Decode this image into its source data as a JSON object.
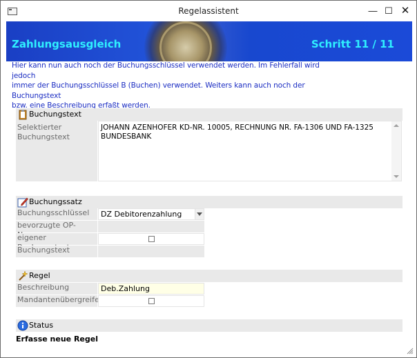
{
  "window": {
    "title": "Regelassistent",
    "minimize_glyph": "—",
    "maximize_glyph": "☐",
    "close_glyph": "✕"
  },
  "banner": {
    "title": "Zahlungsausgleich",
    "step": "Schritt 11 / 11",
    "accent_color": "#2ff0ff",
    "background_color": "#1b4ad8"
  },
  "intro": {
    "lines": [
      "Hier kann nun auch noch der Buchungsschlüssel verwendet werden. Im Fehlerfall wird jedoch",
      "immer der Buchungsschlüssel B (Buchen) verwendet. Weiters kann auch noch der Buchungstext",
      "bzw. eine Beschreibung erfaßt werden."
    ],
    "color": "#1a2cc2"
  },
  "sections": {
    "buchungstext": {
      "heading": "Buchungstext",
      "icon": "clipboard-icon",
      "label": "Selektierter Buchungstext",
      "value_lines": [
        "JOHANN AZENHOFER KD-NR. 10005,  RECHNUNG NR. FA-1306 UND FA-1325",
        "BUNDESBANK"
      ]
    },
    "buchungssatz": {
      "heading": "Buchungssatz",
      "icon": "edit-icon",
      "rows": {
        "schluessel": {
          "label": "Buchungsschlüssel",
          "value": "DZ Debitorenzahlung"
        },
        "op_nummer": {
          "label": "bevorzugte OP-Nummer",
          "value": ""
        },
        "eigener": {
          "label": "eigener Buchungstext",
          "checked": false
        },
        "text": {
          "label": "Buchungstext",
          "value": ""
        }
      }
    },
    "regel": {
      "heading": "Regel",
      "icon": "wand-icon",
      "rows": {
        "beschreibung": {
          "label": "Beschreibung",
          "value": "Deb.Zahlung"
        },
        "mandanten": {
          "label": "Mandantenübergreifend",
          "checked": false
        }
      }
    },
    "status": {
      "heading": "Status",
      "icon": "info-icon",
      "text": "Erfasse neue Regel"
    }
  }
}
